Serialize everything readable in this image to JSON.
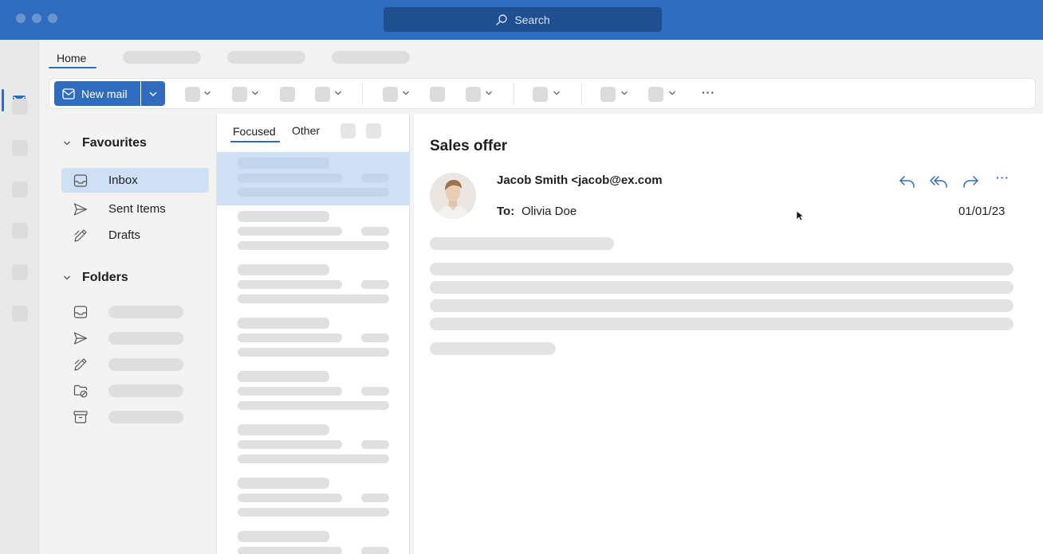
{
  "titlebar": {
    "search_placeholder": "Search",
    "search_icon": "search-icon"
  },
  "rail": {
    "items": [
      "mail-icon",
      "placeholder",
      "placeholder",
      "placeholder",
      "placeholder",
      "placeholder",
      "placeholder"
    ]
  },
  "ribbon_tabs": {
    "active": "Home"
  },
  "ribbon": {
    "new_mail_label": "New mail",
    "new_mail_icon": "mail-icon",
    "more_label": "···"
  },
  "folder_pane": {
    "favourites_label": "Favourites",
    "favourites": [
      {
        "label": "Inbox",
        "icon": "inbox-icon",
        "active": true
      },
      {
        "label": "Sent Items",
        "icon": "send-icon",
        "active": false
      },
      {
        "label": "Drafts",
        "icon": "drafts-icon",
        "active": false
      }
    ],
    "folders_label": "Folders",
    "folders_icons": [
      "inbox-icon",
      "send-icon",
      "drafts-icon",
      "blocked-folder-icon",
      "archive-icon"
    ]
  },
  "message_list": {
    "tabs": [
      "Focused",
      "Other"
    ],
    "active_tab": "Focused",
    "item_count_visible": 8,
    "selected_index": 0
  },
  "reading_pane": {
    "subject": "Sales offer",
    "sender": "Jacob Smith <jacob@ex.com",
    "to_label": "To:",
    "to_name": "Olivia Doe",
    "date": "01/01/23",
    "actions": [
      "reply-icon",
      "reply-all-icon",
      "forward-icon",
      "more-icon"
    ],
    "more_label": "···"
  },
  "colors": {
    "brand": "#2f6cbd",
    "selection": "#cfe0f5",
    "placeholder": "#e0e0e0"
  }
}
